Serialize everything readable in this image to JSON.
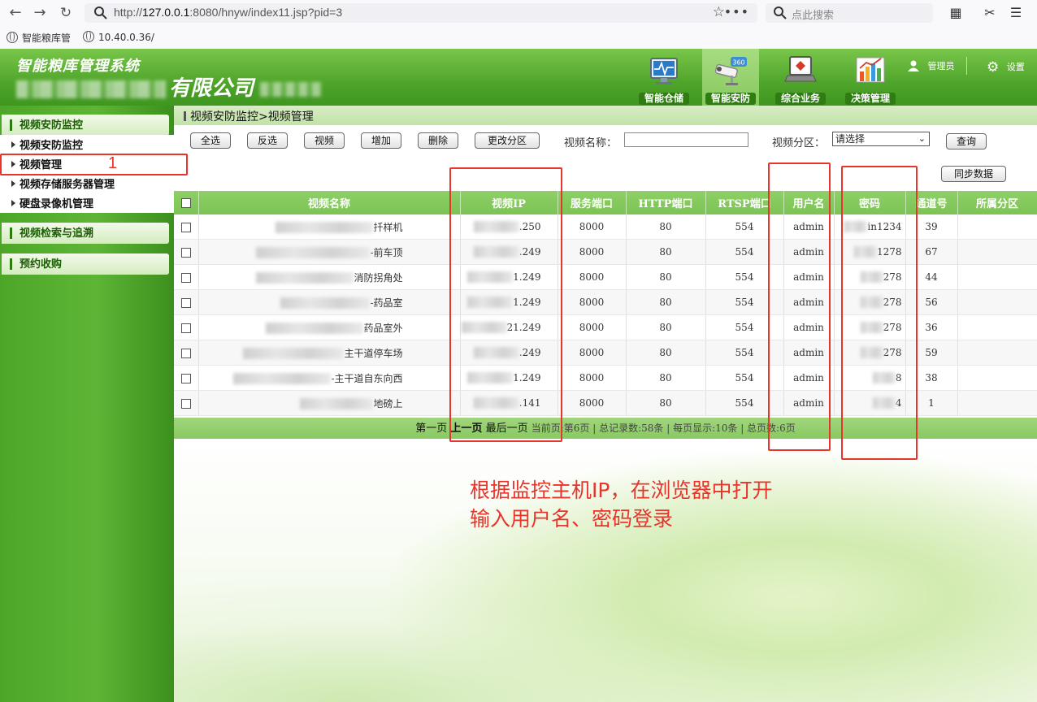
{
  "browser": {
    "url_prefix": "http://",
    "url_host": "127.0.0.1",
    "url_rest": ":8080/hnyw/index11.jsp?pid=3",
    "search_placeholder": "点此搜索",
    "bookmarks": [
      "智能粮库管",
      "10.40.0.36/"
    ]
  },
  "header": {
    "system_title": "智能粮库管理系统",
    "company_visible": "有限公司",
    "modules": [
      {
        "label": "智能仓储",
        "icon": "monitor-icon"
      },
      {
        "label": "智能安防",
        "icon": "security-camera-icon",
        "active": true
      },
      {
        "label": "综合业务",
        "icon": "laptop-icon"
      },
      {
        "label": "决策管理",
        "icon": "bar-chart-icon"
      }
    ],
    "user_label": "管理员",
    "settings_label": "设置"
  },
  "sidebar": {
    "groups": [
      {
        "label": "视频安防监控",
        "items": [
          "视频安防监控",
          "视频管理",
          "视频存储服务器管理",
          "硬盘录像机管理"
        ]
      },
      {
        "label": "视频检索与追溯",
        "items": []
      },
      {
        "label": "预约收购",
        "items": []
      }
    ]
  },
  "main": {
    "breadcrumb": "视频安防监控>视频管理",
    "toolbar": {
      "select_all": "全选",
      "invert": "反选",
      "video": "视频",
      "add": "增加",
      "delete": "删除",
      "change_zone": "更改分区",
      "sync": "同步数据",
      "query": "查询"
    },
    "filters": {
      "name_label": "视频名称：",
      "name_value": "",
      "zone_label": "视频分区：",
      "zone_value": "请选择"
    },
    "table": {
      "headers": [
        "视频名称",
        "视频IP",
        "服务端口",
        "HTTP端口",
        "RTSP端口",
        "用户名",
        "密码",
        "通道号",
        "所属分区"
      ],
      "rows": [
        {
          "name": "扦样机",
          "ip": ".250",
          "service_port": "8000",
          "http_port": "80",
          "rtsp_port": "554",
          "user": "admin",
          "password": "in1234",
          "channel": "39",
          "zone": ""
        },
        {
          "name": "-前车顶",
          "ip": ".249",
          "service_port": "8000",
          "http_port": "80",
          "rtsp_port": "554",
          "user": "admin",
          "password": "1278",
          "channel": "67",
          "zone": ""
        },
        {
          "name": "消防拐角处",
          "ip": "1.249",
          "service_port": "8000",
          "http_port": "80",
          "rtsp_port": "554",
          "user": "admin",
          "password": "278",
          "channel": "44",
          "zone": ""
        },
        {
          "name": "-药品室",
          "ip": "1.249",
          "service_port": "8000",
          "http_port": "80",
          "rtsp_port": "554",
          "user": "admin",
          "password": "278",
          "channel": "56",
          "zone": ""
        },
        {
          "name": "药品室外",
          "ip": "21.249",
          "service_port": "8000",
          "http_port": "80",
          "rtsp_port": "554",
          "user": "admin",
          "password": "278",
          "channel": "36",
          "zone": ""
        },
        {
          "name": "主干道停车场",
          "ip": ".249",
          "service_port": "8000",
          "http_port": "80",
          "rtsp_port": "554",
          "user": "admin",
          "password": "278",
          "channel": "59",
          "zone": ""
        },
        {
          "name": "-主干道自东向西",
          "ip": "1.249",
          "service_port": "8000",
          "http_port": "80",
          "rtsp_port": "554",
          "user": "admin",
          "password": "8",
          "channel": "38",
          "zone": ""
        },
        {
          "name": "地磅上",
          "ip": ".141",
          "service_port": "8000",
          "http_port": "80",
          "rtsp_port": "554",
          "user": "admin",
          "password": "4",
          "channel": "1",
          "zone": ""
        }
      ]
    },
    "pager": {
      "first": "第一页",
      "prev": "上一页",
      "last": "最后一页",
      "info": "当前页:第6页 | 总记录数:58条 | 每页显示:10条 | 总页数:6页"
    },
    "annotation": {
      "line1": "根据监控主机IP，在浏览器中打开",
      "line2": "输入用户名、密码登录",
      "marker": "1"
    }
  },
  "colors": {
    "header_green": "#4fa52a",
    "table_header": "#8ed067",
    "annotation_red": "#e8352b"
  }
}
